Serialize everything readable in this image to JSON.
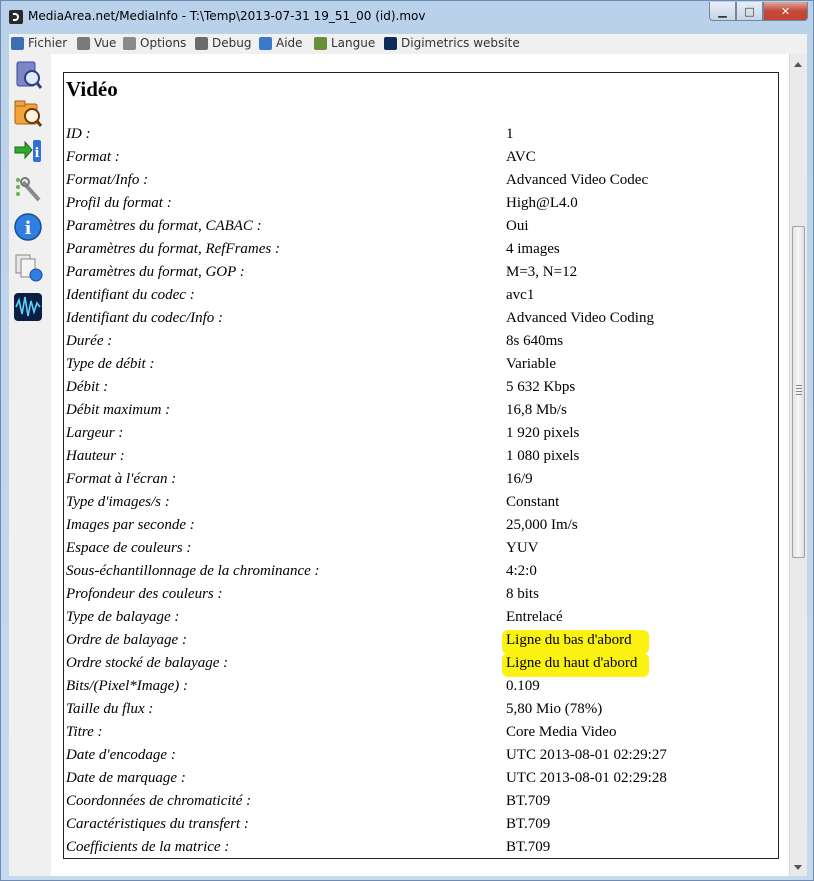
{
  "window": {
    "title": "MediaArea.net/MediaInfo - T:\\Temp\\2013-07-31 19_51_00 (id).mov",
    "minimize": "▁",
    "maximize": "□",
    "close": "✕"
  },
  "menu": [
    {
      "label": "Fichier",
      "icon": "file-icon",
      "color": "#3b6fb5"
    },
    {
      "label": "Vue",
      "icon": "view-icon",
      "color": "#7a7a7a"
    },
    {
      "label": "Options",
      "icon": "options-icon",
      "color": "#8a8a8a"
    },
    {
      "label": "Debug",
      "icon": "debug-icon",
      "color": "#6b6b6b"
    },
    {
      "label": "Aide",
      "icon": "help-icon",
      "color": "#3a78c8"
    },
    {
      "label": "Langue",
      "icon": "language-icon",
      "color": "#6a8f3a"
    },
    {
      "label": "Digimetrics website",
      "icon": "digimetrics-icon",
      "color": "#0b2b5a"
    }
  ],
  "toolbar": [
    {
      "icon": "open-file-icon"
    },
    {
      "icon": "open-folder-icon"
    },
    {
      "icon": "export-icon"
    },
    {
      "icon": "preferences-icon"
    },
    {
      "icon": "about-icon"
    },
    {
      "icon": "copy-icon"
    },
    {
      "icon": "waveform-icon"
    }
  ],
  "section": {
    "heading": "Vidéo",
    "rows": [
      {
        "label": "ID :",
        "value": "1"
      },
      {
        "label": "Format :",
        "value": "AVC"
      },
      {
        "label": "Format/Info :",
        "value": "Advanced Video Codec"
      },
      {
        "label": "Profil du format :",
        "value": "High@L4.0"
      },
      {
        "label": "Paramètres du format, CABAC :",
        "value": "Oui"
      },
      {
        "label": "Paramètres du format, RefFrames :",
        "value": "4 images"
      },
      {
        "label": "Paramètres du format, GOP :",
        "value": "M=3, N=12"
      },
      {
        "label": "Identifiant du codec :",
        "value": "avc1"
      },
      {
        "label": "Identifiant du codec/Info :",
        "value": "Advanced Video Coding"
      },
      {
        "label": "Durée :",
        "value": "8s 640ms"
      },
      {
        "label": "Type de débit :",
        "value": "Variable"
      },
      {
        "label": "Débit :",
        "value": "5 632 Kbps"
      },
      {
        "label": "Débit maximum :",
        "value": "16,8 Mb/s"
      },
      {
        "label": "Largeur :",
        "value": "1 920 pixels"
      },
      {
        "label": "Hauteur :",
        "value": "1 080 pixels"
      },
      {
        "label": "Format à l'écran :",
        "value": "16/9"
      },
      {
        "label": "Type d'images/s :",
        "value": "Constant"
      },
      {
        "label": "Images par seconde :",
        "value": "25,000 Im/s"
      },
      {
        "label": "Espace de couleurs :",
        "value": "YUV"
      },
      {
        "label": "Sous-échantillonnage de la chrominance :",
        "value": "4:2:0"
      },
      {
        "label": "Profondeur des couleurs :",
        "value": "8 bits"
      },
      {
        "label": "Type de balayage :",
        "value": "Entrelacé"
      },
      {
        "label": "Ordre de balayage :",
        "value": "Ligne du bas d'abord",
        "highlight": true
      },
      {
        "label": "Ordre stocké de balayage :",
        "value": "Ligne du haut d'abord",
        "highlight": true
      },
      {
        "label": "Bits/(Pixel*Image) :",
        "value": "0.109"
      },
      {
        "label": "Taille du flux :",
        "value": "5,80 Mio (78%)"
      },
      {
        "label": "Titre :",
        "value": "Core Media Video"
      },
      {
        "label": "Date d'encodage :",
        "value": "UTC 2013-08-01 02:29:27"
      },
      {
        "label": "Date de marquage :",
        "value": "UTC 2013-08-01 02:29:28"
      },
      {
        "label": "Coordonnées de chromaticité :",
        "value": "BT.709"
      },
      {
        "label": "Caractéristiques du transfert :",
        "value": "BT.709"
      },
      {
        "label": "Coefficients de la matrice :",
        "value": "BT.709"
      }
    ]
  },
  "colors": {
    "highlight": "#fbf212"
  }
}
